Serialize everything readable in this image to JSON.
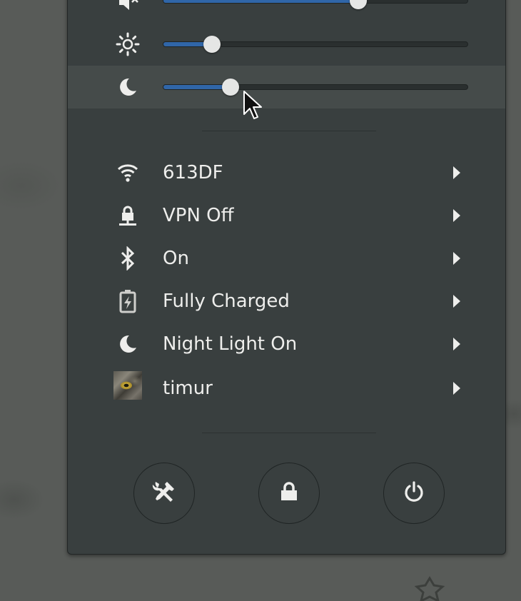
{
  "sliders": [
    {
      "name": "volume",
      "icon": "speaker-muted-icon",
      "level": 0.64
    },
    {
      "name": "brightness",
      "icon": "brightness-icon",
      "level": 0.16
    },
    {
      "name": "night-light",
      "icon": "moon-icon",
      "level": 0.22
    }
  ],
  "menu": {
    "wifi": {
      "label": "613DF",
      "icon": "wifi-icon"
    },
    "vpn": {
      "label": "VPN Off",
      "icon": "vpn-icon"
    },
    "bluetooth": {
      "label": "On",
      "icon": "bluetooth-icon"
    },
    "battery": {
      "label": "Fully Charged",
      "icon": "battery-icon"
    },
    "night_light": {
      "label": "Night Light On",
      "icon": "moon-icon"
    },
    "user": {
      "label": "timur",
      "icon": "avatar"
    }
  },
  "buttons": [
    "settings-button",
    "lock-button",
    "power-button"
  ],
  "colors": {
    "accent": "#3066a8",
    "panel": "#393f3f",
    "text": "#eeeeec"
  }
}
